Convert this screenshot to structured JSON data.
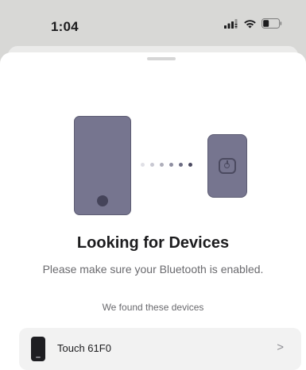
{
  "status_bar": {
    "time": "1:04",
    "icons": [
      "signal-icon",
      "wifi-icon",
      "battery-icon"
    ]
  },
  "illustration": {
    "phone_color": "#76758f",
    "tag_color": "#76758f",
    "dot_colors": [
      "#e0e0e6",
      "#c8c8d2",
      "#aeaeba",
      "#8e8ea0",
      "#6c6c82",
      "#4b4a60"
    ]
  },
  "main": {
    "title": "Looking for Devices",
    "subtitle": "Please make sure your Bluetooth is enabled.",
    "found_label": "We found these devices"
  },
  "devices": [
    {
      "name": "Touch 61F0",
      "icon": "phone-device-icon",
      "chevron": ">"
    }
  ]
}
